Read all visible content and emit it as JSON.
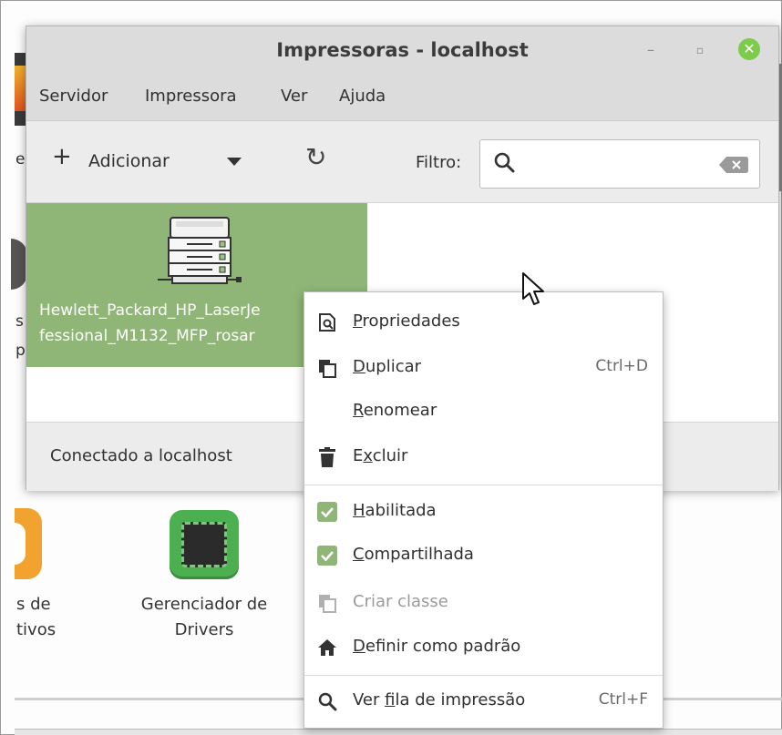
{
  "window": {
    "title": "Impressoras - localhost",
    "controls": {
      "minimize": "–",
      "maximize": "▫",
      "close": "✕"
    }
  },
  "menubar": {
    "items": [
      "Servidor",
      "Impressora",
      "Ver",
      "Ajuda"
    ]
  },
  "toolbar": {
    "add_label": "Adicionar",
    "filter_label": "Filtro:",
    "search": {
      "value": "",
      "placeholder": ""
    }
  },
  "printers": [
    {
      "name_line1": "Hewlett_Packard_HP_LaserJe",
      "name_line2": "fessional_M1132_MFP_rosar",
      "selected": true
    }
  ],
  "statusbar": {
    "text": "Conectado a localhost"
  },
  "context_menu": {
    "items": [
      {
        "pre": "",
        "accel": "P",
        "post": "ropriedades",
        "shortcut": "",
        "icon": "properties-icon"
      },
      {
        "pre": "",
        "accel": "D",
        "post": "uplicar",
        "shortcut": "Ctrl+D",
        "icon": "duplicate-icon"
      },
      {
        "pre": "",
        "accel": "R",
        "post": "enomear",
        "shortcut": "",
        "icon": ""
      },
      {
        "pre": "E",
        "accel": "x",
        "post": "cluir",
        "shortcut": "",
        "icon": "trash-icon"
      },
      {
        "pre": "",
        "accel": "H",
        "post": "abilitada",
        "shortcut": "",
        "icon": "checkbox-checked-icon",
        "checked": true
      },
      {
        "pre": "",
        "accel": "C",
        "post": "ompartilhada",
        "shortcut": "",
        "icon": "checkbox-checked-icon",
        "checked": true
      },
      {
        "pre": "",
        "accel": "",
        "post": "Criar classe",
        "shortcut": "",
        "icon": "copy-class-icon",
        "disabled": true
      },
      {
        "pre": "",
        "accel": "D",
        "post": "efinir como padrão",
        "shortcut": "",
        "icon": "home-icon"
      },
      {
        "pre": "Ver ",
        "accel": "f",
        "post": "ila de impressão",
        "shortcut": "Ctrl+F",
        "icon": "search-icon"
      }
    ]
  },
  "background_apps": [
    {
      "line1": "s de",
      "line2": "tivos"
    },
    {
      "line1": "Gerenciador de",
      "line2": "Drivers"
    }
  ],
  "background_side_labels": [
    "e",
    "s",
    "p"
  ],
  "colors": {
    "selection": "#8fb676",
    "close_button": "#7ccb4a",
    "drivers_icon": "#4caf50",
    "titlebar": "#dcdcdc"
  }
}
